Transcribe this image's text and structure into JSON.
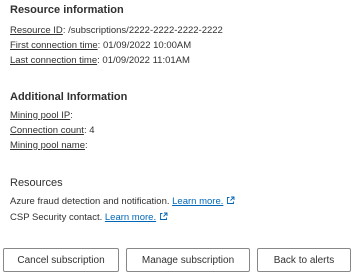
{
  "resource_information": {
    "heading": "Resource information",
    "resource_id": {
      "label": "Resource ID",
      "value": "/subscriptions/2222-2222-2222-2222"
    },
    "first_connection": {
      "label": "First connection time",
      "value": "01/09/2022 10:00AM"
    },
    "last_connection": {
      "label": "Last connection time",
      "value": "01/09/2022 11:01AM"
    }
  },
  "additional_information": {
    "heading": "Additional Information",
    "mining_pool_ip": {
      "label": "Mining pool IP",
      "value": ""
    },
    "connection_count": {
      "label": "Connection count",
      "value": "4"
    },
    "mining_pool_name": {
      "label": "Mining pool name",
      "value": ""
    }
  },
  "resources": {
    "heading": "Resources",
    "items": [
      {
        "text": "Azure fraud detection and notification.",
        "link": "Learn more.",
        "icon": "external-link-icon"
      },
      {
        "text": "CSP Security contact.",
        "link": "Learn more.",
        "icon": "external-link-icon"
      }
    ]
  },
  "buttons": {
    "cancel": "Cancel subscription",
    "manage": "Manage subscription",
    "back": "Back to alerts"
  }
}
